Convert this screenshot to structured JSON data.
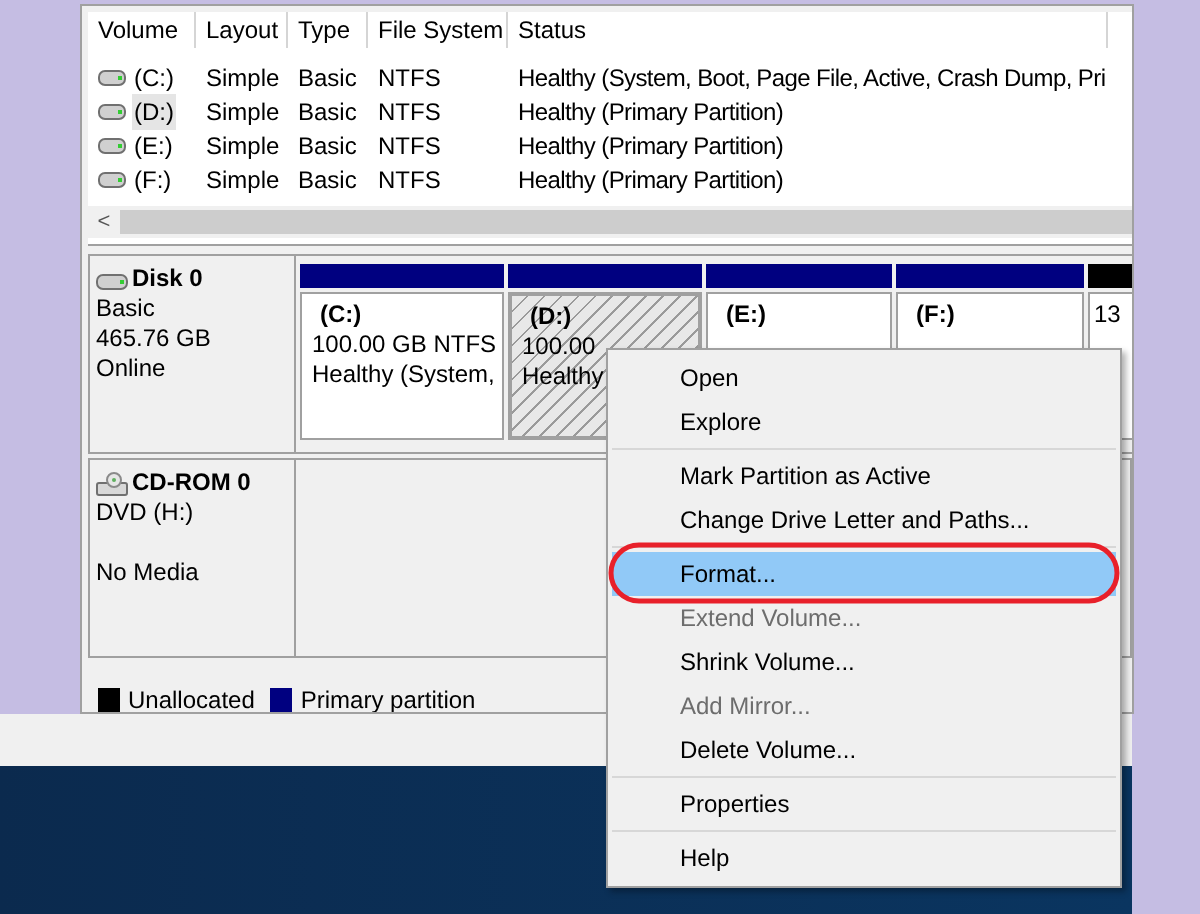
{
  "volume_table": {
    "columns": [
      "Volume",
      "Layout",
      "Type",
      "File System",
      "Status"
    ],
    "rows": [
      {
        "cells": [
          "(C:)",
          "Simple",
          "Basic",
          "NTFS",
          "Healthy (System, Boot, Page File, Active, Crash Dump, Pri"
        ],
        "selected": false
      },
      {
        "cells": [
          "(D:)",
          "Simple",
          "Basic",
          "NTFS",
          "Healthy (Primary Partition)"
        ],
        "selected": true
      },
      {
        "cells": [
          "(E:)",
          "Simple",
          "Basic",
          "NTFS",
          "Healthy (Primary Partition)"
        ],
        "selected": false
      },
      {
        "cells": [
          "(F:)",
          "Simple",
          "Basic",
          "NTFS",
          "Healthy (Primary Partition)"
        ],
        "selected": false
      }
    ],
    "scroll_left": "<"
  },
  "disks": [
    {
      "kind": "disk",
      "name": "Disk 0",
      "lines": [
        "Basic",
        "465.76 GB",
        "Online"
      ],
      "partitions": [
        {
          "kind": "primary",
          "lines": [
            "(C:)",
            "100.00 GB NTFS",
            "Healthy (System,"
          ],
          "selected": false
        },
        {
          "kind": "primary",
          "lines": [
            "(D:)",
            "100.00",
            "Healthy"
          ],
          "selected": true
        },
        {
          "kind": "primary",
          "lines": [
            "(E:)"
          ],
          "selected": false
        },
        {
          "kind": "primary",
          "lines": [
            "(F:)"
          ],
          "selected": false
        },
        {
          "kind": "unallocated",
          "lines": [
            "13"
          ],
          "selected": false
        }
      ]
    },
    {
      "kind": "cdrom",
      "name": "CD-ROM 0",
      "lines": [
        "DVD (H:)",
        "No Media"
      ]
    }
  ],
  "legend": [
    {
      "label": "Unallocated",
      "color": "#000000"
    },
    {
      "label": "Primary partition",
      "color": "#000080"
    }
  ],
  "context_menu": [
    {
      "label": "Open",
      "disabled": false,
      "selected": false,
      "separator_after": false
    },
    {
      "label": "Explore",
      "disabled": false,
      "selected": false,
      "separator_after": true
    },
    {
      "label": "Mark Partition as Active",
      "disabled": false,
      "selected": false,
      "separator_after": false
    },
    {
      "label": "Change Drive Letter and Paths...",
      "disabled": false,
      "selected": false,
      "separator_after": true
    },
    {
      "label": "Format...",
      "disabled": false,
      "selected": true,
      "separator_after": false
    },
    {
      "label": "Extend Volume...",
      "disabled": true,
      "selected": false,
      "separator_after": false
    },
    {
      "label": "Shrink Volume...",
      "disabled": false,
      "selected": false,
      "separator_after": false
    },
    {
      "label": "Add Mirror...",
      "disabled": true,
      "selected": false,
      "separator_after": false
    },
    {
      "label": "Delete Volume...",
      "disabled": false,
      "selected": false,
      "separator_after": true
    },
    {
      "label": "Properties",
      "disabled": false,
      "selected": false,
      "separator_after": true
    },
    {
      "label": "Help",
      "disabled": false,
      "selected": false,
      "separator_after": false
    }
  ]
}
